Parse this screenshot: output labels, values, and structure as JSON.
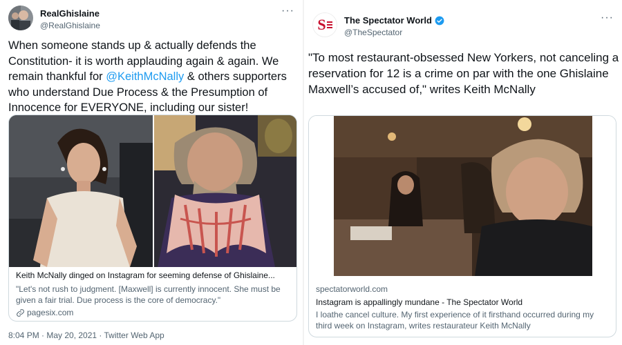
{
  "left_tweet": {
    "author": {
      "name": "RealGhislaine",
      "handle": "@RealGhislaine"
    },
    "more_label": "···",
    "text_before": "When someone stands up & actually defends the Constitution- it is worth applauding again & again.  We remain thankful for ",
    "mention": "@KeithMcNally",
    "text_after": " & others supporters who understand Due Process & the Presumption of Innocence for EVERYONE, including our sister!",
    "card": {
      "title": "Keith McNally dinged on Instagram for seeming defense of Ghislaine...",
      "description": "\"Let's not rush to judgment. [Maxwell] is currently innocent. She must be given a fair trial. Due process is the core of democracy.\"",
      "domain": "pagesix.com",
      "link_icon": "link-icon"
    },
    "timestamp": "8:04 PM · May 20, 2021 · Twitter Web App"
  },
  "right_tweet": {
    "author": {
      "name": "The Spectator World",
      "handle": "@TheSpectator",
      "verified": true
    },
    "logo_text": "S",
    "more_label": "···",
    "text": "\"To most restaurant-obsessed New Yorkers, not canceling a reservation for 12 is a crime on par with the one Ghislaine Maxwell’s accused of,\" writes Keith McNally",
    "card": {
      "domain": "spectatorworld.com",
      "title": "Instagram is appallingly mundane - The Spectator World",
      "description": "I loathe cancel culture. My first experience of it firsthand occurred during my third week on Instagram, writes restaurateur Keith McNally"
    }
  },
  "colors": {
    "accent": "#1d9bf0",
    "muted": "#536471",
    "text": "#0f1419",
    "border": "#cfd9de",
    "brand_red": "#c8102e"
  }
}
